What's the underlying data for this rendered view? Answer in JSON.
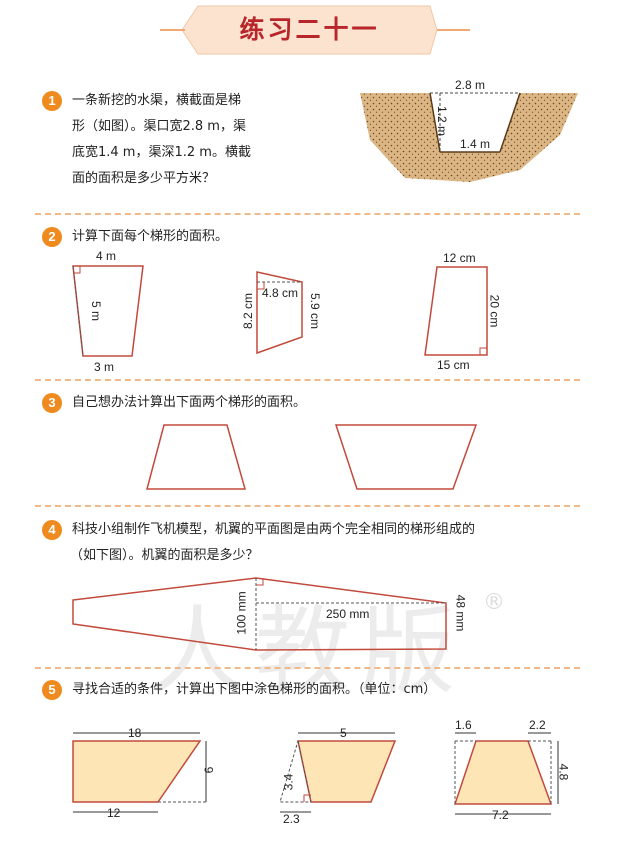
{
  "title": "练习二十一",
  "colors": {
    "accent": "#ef8a1f",
    "title_red": "#b8262b",
    "banner": "#fbe3cf",
    "fill": "#fde5b5",
    "soil": "#d9b27c"
  },
  "q1": {
    "num": "1",
    "lines": [
      "一条新挖的水渠，横截面是梯",
      "形（如图）。渠口宽2.8 m，渠",
      "底宽1.4 m，渠深1.2 m。横截",
      "面的面积是多少平方米？"
    ],
    "top": "2.8 m",
    "bottom": "1.4 m",
    "depth": "1.2 m"
  },
  "q2": {
    "num": "2",
    "text": "计算下面每个梯形的面积。",
    "t1": {
      "top": "4 m",
      "height": "5 m",
      "bottom": "3 m"
    },
    "t2": {
      "left": "8.2 cm",
      "width": "4.8 cm",
      "right": "5.9 cm"
    },
    "t3": {
      "top": "12 cm",
      "height": "20 cm",
      "bottom": "15 cm"
    }
  },
  "q3": {
    "num": "3",
    "text": "自己想办法计算出下面两个梯形的面积。"
  },
  "q4": {
    "num": "4",
    "line1": "科技小组制作飞机模型，机翼的平面图是由两个完全相同的梯形组成的",
    "line2": "（如下图）。机翼的面积是多少？",
    "height": "100 mm",
    "width": "250 mm",
    "end": "48 mm",
    "watermark": "人教版",
    "registered": "®"
  },
  "q5": {
    "num": "5",
    "text": "寻找合适的条件，计算出下图中涂色梯形的面积。（单位：cm）",
    "f1": {
      "top": "18",
      "height": "9",
      "bottom": "12"
    },
    "f2": {
      "top": "5",
      "height": "3.4",
      "base": "2.3"
    },
    "f3": {
      "left": "1.6",
      "right": "2.2",
      "height": "4.8",
      "bottom": "7.2"
    }
  }
}
